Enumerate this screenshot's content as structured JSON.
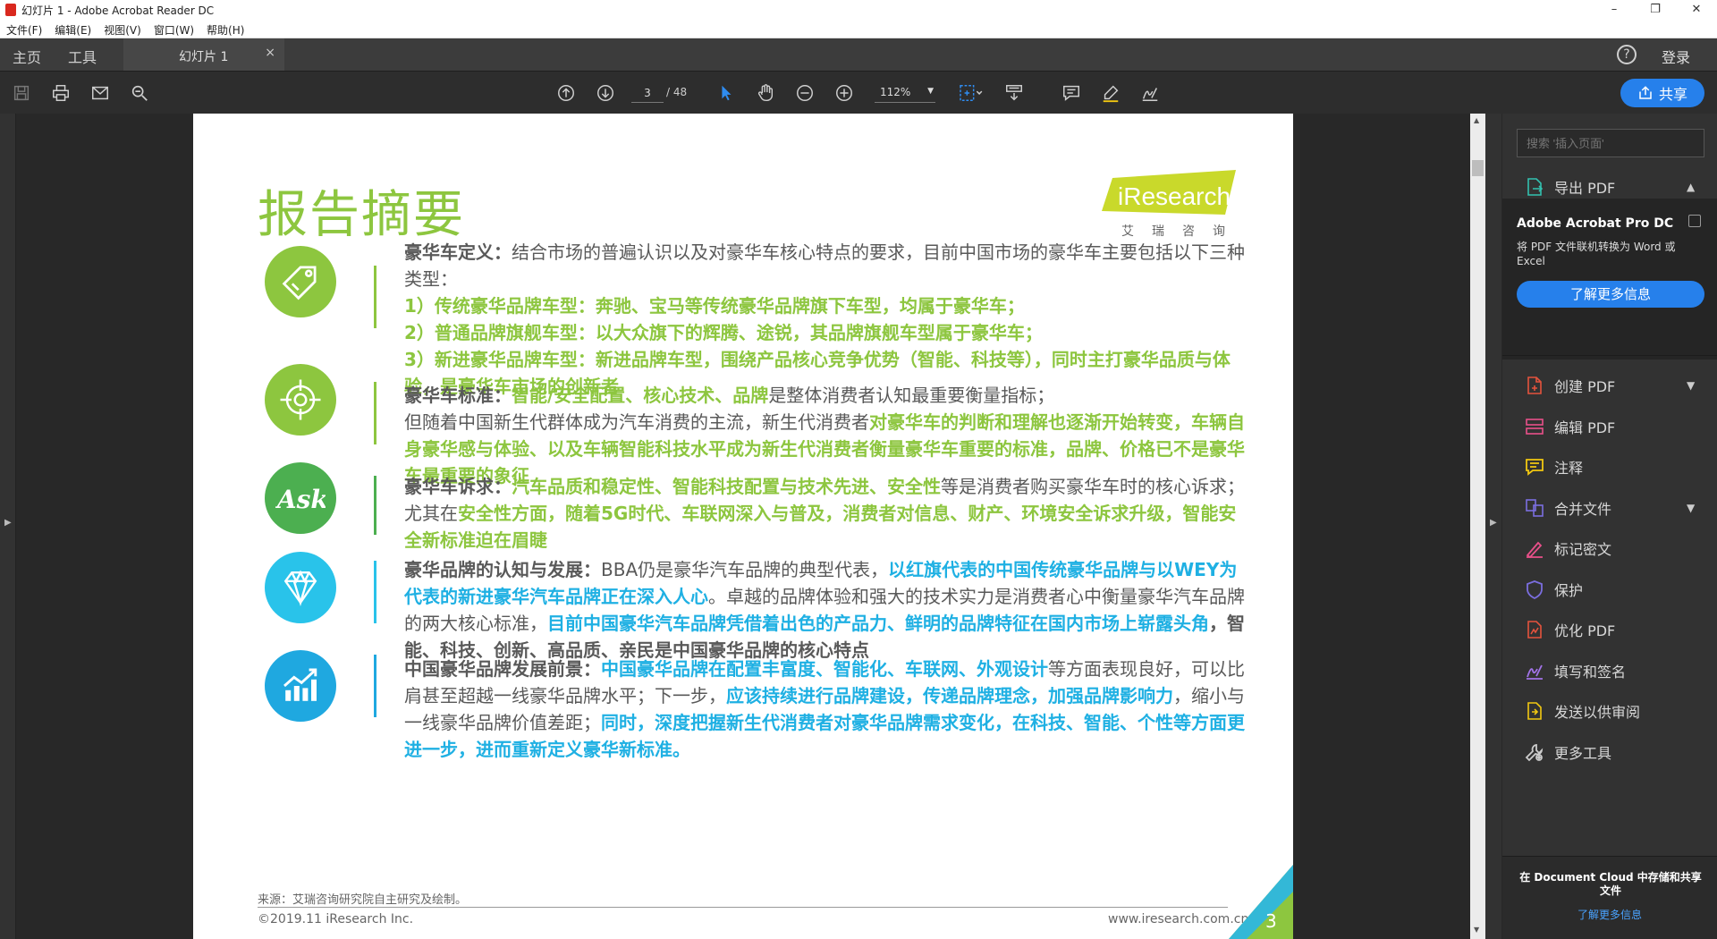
{
  "window": {
    "title": "幻灯片 1 - Adobe Acrobat Reader DC",
    "controls": [
      "–",
      "❐",
      "✕"
    ]
  },
  "menu": [
    "文件(F)",
    "编辑(E)",
    "视图(V)",
    "窗口(W)",
    "帮助(H)"
  ],
  "tabs": {
    "home": "主页",
    "tools": "工具",
    "doc": "幻灯片 1",
    "close": "×",
    "help": "?",
    "login": "登录"
  },
  "toolbar": {
    "page_current": "3",
    "page_total": "/ 48",
    "zoom": "112%",
    "share_label": "共享"
  },
  "slide": {
    "title": "报告摘要",
    "logo_word": "iResearch",
    "logo_sub": "艾瑞咨询",
    "sections": [
      {
        "icon": "tag-icon",
        "color": "#8dc63f",
        "heading": "豪华车定义：",
        "parts": [
          {
            "t": "结合市场的普遍认识以及对豪华车核心特点的要求，目前中国市场的豪华车主要包括以下三种类型：",
            "s": "n"
          },
          {
            "t": "1）传统豪华品牌车型：奔驰、宝马等传统豪华品牌旗下车型，均属于豪华车；",
            "s": "g",
            "br": true
          },
          {
            "t": "2）普通品牌旗舰车型：以大众旗下的辉腾、途锐，其品牌旗舰车型属于豪华车；",
            "s": "g",
            "br": true
          },
          {
            "t": "3）新进豪华品牌车型：新进品牌车型，围绕产品核心竞争优势（智能、科技等），同时主打豪华品质与体验，是豪华车市场的创新者",
            "s": "g",
            "br": true
          }
        ]
      },
      {
        "icon": "target-icon",
        "color": "#8dc63f",
        "heading": "豪华车标准：",
        "parts": [
          {
            "t": "智能/安全配置、核心技术、品牌",
            "s": "g"
          },
          {
            "t": "是整体消费者认知最重要衡量指标；",
            "s": "n"
          },
          {
            "t": "但随着中国新生代群体成为汽车消费的主流，新生代消费者",
            "s": "n",
            "br": true
          },
          {
            "t": "对豪华车的判断和理解也逐渐开始转变，车辆自身豪华感与体验、以及车辆智能科技水平成为新生代消费者衡量豪华车重要的标准，品牌、价格已不是豪华车最重要的象征",
            "s": "g"
          }
        ]
      },
      {
        "icon": "ask-icon",
        "color": "#4caf50",
        "heading": "豪华车诉求：",
        "parts": [
          {
            "t": "汽车品质和稳定性、智能科技配置与技术先进、安全性",
            "s": "g"
          },
          {
            "t": "等是消费者购买豪华车时的核心诉求；尤其在",
            "s": "n"
          },
          {
            "t": "安全性方面，随着5G时代、车联网深入与普及，消费者对信息、财产、环境安全诉求升级，智能安全新标准迫在眉睫",
            "s": "g"
          }
        ]
      },
      {
        "icon": "diamond-icon",
        "color": "#29c3ea",
        "heading": "豪华品牌的认知与发展：",
        "parts": [
          {
            "t": "BBA仍是豪华汽车品牌的典型代表，",
            "s": "n"
          },
          {
            "t": "以红旗代表的中国传统豪华品牌与以WEY为代表的新进豪华汽车品牌正在深入人心",
            "s": "b"
          },
          {
            "t": "。卓越的品牌体验和强大的技术实力是消费者心中衡量豪华汽车品牌的两大核心标准，",
            "s": "n"
          },
          {
            "t": "目前中国豪华汽车品牌凭借着出色的产品力、鲜明的品牌特征在国内市场上崭露头角",
            "s": "b"
          },
          {
            "t": "，智能、科技、创新、高品质、亲民是中国豪华品牌的核心特点",
            "s": "k"
          }
        ]
      },
      {
        "icon": "growth-chart-icon",
        "color": "#1fa8e0",
        "heading": "中国豪华品牌发展前景：",
        "parts": [
          {
            "t": "中国豪华品牌在配置丰富度、智能化、车联网、外观设计",
            "s": "b"
          },
          {
            "t": "等方面表现良好，可以比肩甚至超越一线豪华品牌水平；下一步，",
            "s": "n"
          },
          {
            "t": "应该持续进行品牌建设，传递品牌理念，加强品牌影响力",
            "s": "b"
          },
          {
            "t": "，缩小与一线豪华品牌价值差距；",
            "s": "n"
          },
          {
            "t": "同时，深度把握新生代消费者对豪华品牌需求变化，在科技、智能、个性等方面更进一步，进而重新定义豪华新标准。",
            "s": "b"
          }
        ]
      }
    ],
    "source": "来源：艾瑞咨询研究院自主研究及绘制。",
    "copyright": "©2019.11 iResearch Inc.",
    "site": "www.iresearch.com.cn",
    "page_number": "3"
  },
  "right_panel": {
    "search_placeholder": "搜索 '插入页面'",
    "export_label": "导出 PDF",
    "promo_title": "Adobe Acrobat Pro DC",
    "promo_desc": "将 PDF 文件联机转换为 Word 或 Excel",
    "promo_button": "了解更多信息",
    "tools": [
      {
        "label": "创建 PDF",
        "icon": "create-pdf-icon",
        "color": "#e5533d",
        "chev": true
      },
      {
        "label": "编辑 PDF",
        "icon": "edit-pdf-icon",
        "color": "#e9508a",
        "chev": false
      },
      {
        "label": "注释",
        "icon": "comment-icon",
        "color": "#f2c811",
        "chev": false
      },
      {
        "label": "合并文件",
        "icon": "combine-files-icon",
        "color": "#7b6ee0",
        "chev": true
      },
      {
        "label": "标记密文",
        "icon": "redact-icon",
        "color": "#e9508a",
        "chev": false
      },
      {
        "label": "保护",
        "icon": "protect-icon",
        "color": "#7b6ee0",
        "chev": false
      },
      {
        "label": "优化 PDF",
        "icon": "optimize-pdf-icon",
        "color": "#e5533d",
        "chev": false
      },
      {
        "label": "填写和签名",
        "icon": "fill-sign-icon",
        "color": "#a273e8",
        "chev": false
      },
      {
        "label": "发送以供审阅",
        "icon": "send-review-icon",
        "color": "#f2c811",
        "chev": false
      },
      {
        "label": "更多工具",
        "icon": "more-tools-icon",
        "color": "#cccccc",
        "chev": false
      }
    ],
    "cloud_text": "在 Document Cloud 中存储和共享文件",
    "cloud_link": "了解更多信息"
  }
}
